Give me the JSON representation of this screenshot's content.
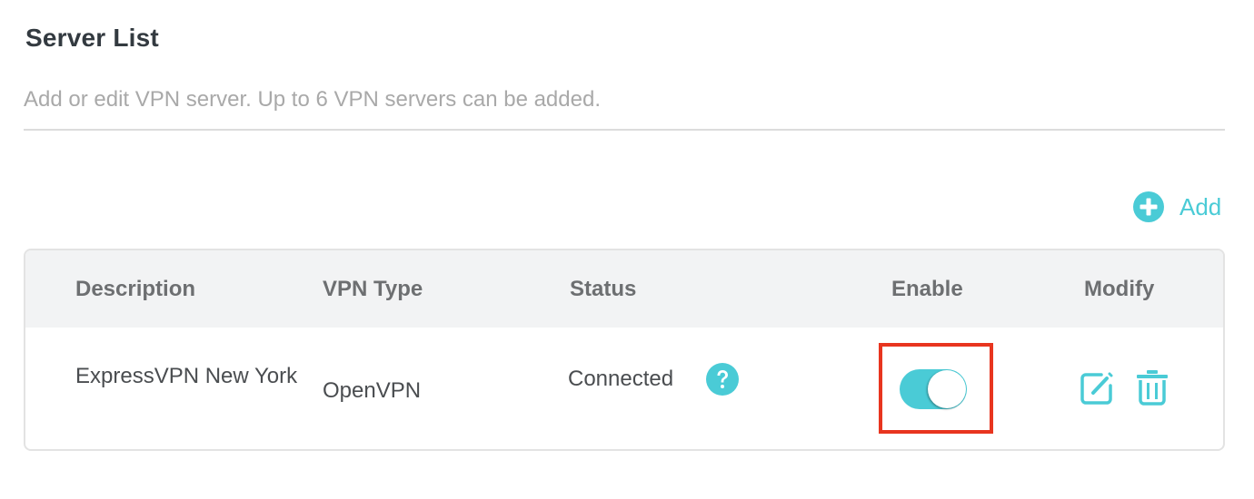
{
  "header": {
    "title": "Server List",
    "subtitle": "Add or edit VPN server. Up to 6 VPN servers can be added."
  },
  "toolbar": {
    "add_icon": "plus-circle-icon",
    "add_label": "Add"
  },
  "table": {
    "columns": [
      "Description",
      "VPN Type",
      "Status",
      "Enable",
      "Modify"
    ],
    "rows": [
      {
        "description": "ExpressVPN New York",
        "vpn_type": "OpenVPN",
        "status": "Connected",
        "status_icon": "question-circle-icon",
        "enabled": true,
        "modify_icons": [
          "edit-icon",
          "trash-icon"
        ]
      }
    ]
  },
  "colors": {
    "accent": "#4acbd6",
    "highlight_border": "#e8351f",
    "title_text": "#333a40",
    "subtitle_text": "#a9a9a9",
    "header_bg": "#f2f3f4"
  }
}
